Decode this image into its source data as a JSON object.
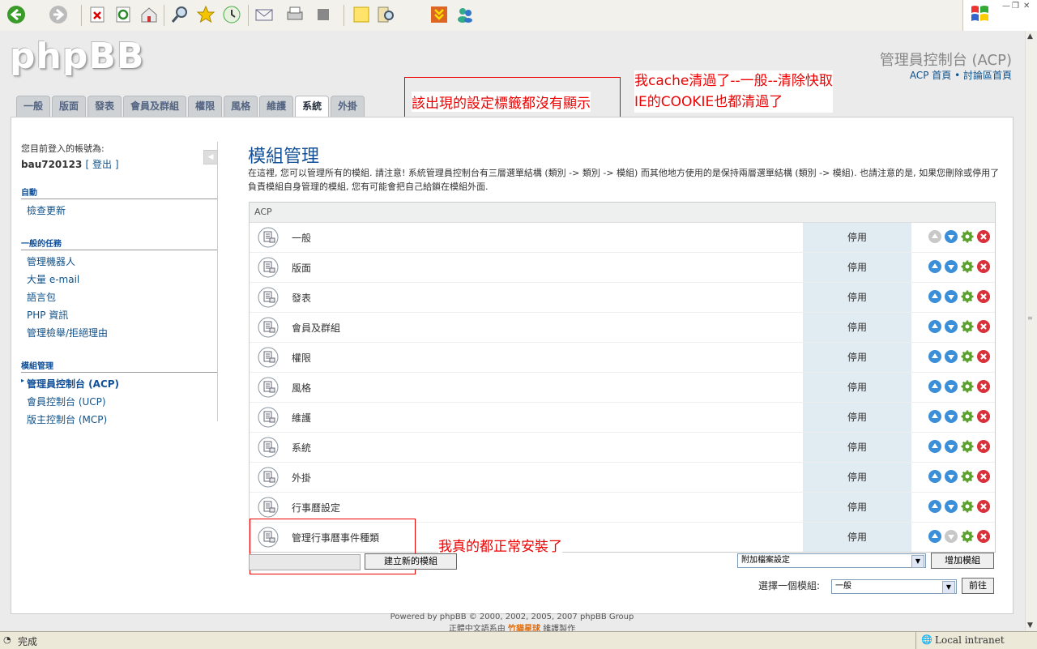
{
  "browser": {
    "toolbar_icons": [
      "back-icon",
      "forward-icon",
      "stop-icon",
      "refresh-icon",
      "home-icon",
      "search-icon",
      "favorites-icon",
      "history-icon",
      "mail-icon",
      "print-icon",
      "edit-icon",
      "notes-icon",
      "research-icon",
      "flashget-icon",
      "messenger-icon"
    ],
    "status_text": "完成",
    "zone_text": "Local intranet"
  },
  "header": {
    "logo": "phpBB",
    "title": "管理員控制台 (ACP)",
    "link_acp_home": "ACP 首頁",
    "separator": "•",
    "link_forum_home": "討論區首頁"
  },
  "tabs": [
    "一般",
    "版面",
    "發表",
    "會員及群組",
    "權限",
    "風格",
    "維護",
    "系統",
    "外掛"
  ],
  "active_tab_index": 7,
  "annotations": {
    "a1": "該出現的設定標籤都沒有顯示",
    "a2_line1": "我cache清過了--一般--清除快取",
    "a2_line2": "IE的COOKIE也都清過了",
    "a3": "我真的都正常安裝了"
  },
  "sidebar": {
    "login_label": "您目前登入的帳號為:",
    "username": "bau720123",
    "logout": "[ 登出 ]",
    "sections": [
      {
        "title": "自動",
        "items": [
          "檢查更新"
        ]
      },
      {
        "title": "一般的任務",
        "items": [
          "管理機器人",
          "大量 e-mail",
          "語言包",
          "PHP 資訊",
          "管理檢舉/拒絕理由"
        ]
      },
      {
        "title": "模組管理",
        "items": [
          "管理員控制台 (ACP)",
          "會員控制台 (UCP)",
          "版主控制台 (MCP)"
        ]
      }
    ]
  },
  "main": {
    "title": "模組管理",
    "intro": "在這裡, 您可以管理所有的模組. 請注意! 系統管理員控制台有三層選單結構 (類別 -> 類別 -> 模組) 而其他地方使用的是保持兩層選單結構 (類別 -> 模組). 也請注意的是, 如果您刪除或停用了負責模組自身管理的模組, 您有可能會把自己給鎖在模組外面.",
    "table_header": "ACP",
    "rows": [
      {
        "name": "一般",
        "status": "停用"
      },
      {
        "name": "版面",
        "status": "停用"
      },
      {
        "name": "發表",
        "status": "停用"
      },
      {
        "name": "會員及群組",
        "status": "停用"
      },
      {
        "name": "權限",
        "status": "停用"
      },
      {
        "name": "風格",
        "status": "停用"
      },
      {
        "name": "維護",
        "status": "停用"
      },
      {
        "name": "系統",
        "status": "停用"
      },
      {
        "name": "外掛",
        "status": "停用"
      },
      {
        "name": "行事曆設定",
        "status": "停用"
      },
      {
        "name": "管理行事曆事件種類",
        "status": "停用"
      }
    ],
    "create_button": "建立新的模組",
    "add_select_value": "附加檔案設定",
    "add_button": "增加模組",
    "choose_label": "選擇一個模組:",
    "choose_select_value": "一般",
    "go_button": "前往"
  },
  "footer": {
    "line1": "Powered by phpBB © 2000, 2002, 2005, 2007 phpBB Group",
    "line2_pre": "正體中文語系由",
    "line2_link": "竹貓星球",
    "line2_post": "維護製作"
  },
  "colors": {
    "accent": "#105289",
    "status_cell": "#e1ebf2",
    "annotation": "#ee0000"
  }
}
